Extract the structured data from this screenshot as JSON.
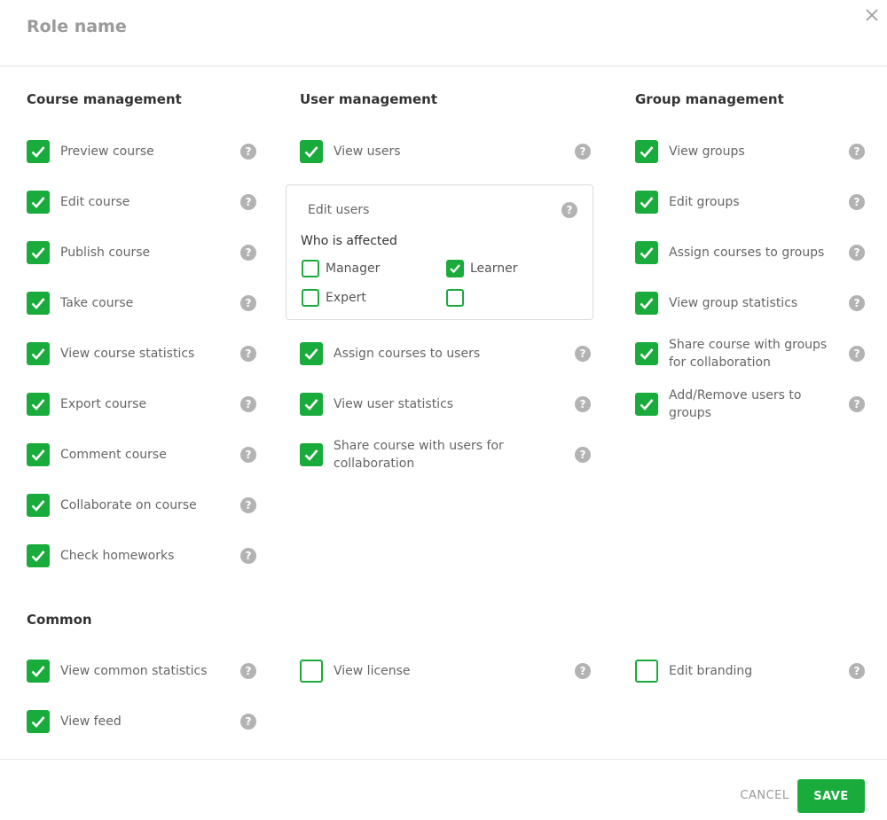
{
  "dialog": {
    "title": "Role name"
  },
  "icons": {
    "close": "close-icon",
    "help": "help-icon",
    "check": "check-icon"
  },
  "colors": {
    "accent": "#1aab3d",
    "help_icon": "#b3b3b3"
  },
  "help_glyph": "?",
  "course_management": {
    "title": "Course management",
    "items": [
      {
        "label": "Preview course",
        "checked": true
      },
      {
        "label": "Edit course",
        "checked": true
      },
      {
        "label": "Publish course",
        "checked": true
      },
      {
        "label": "Take course",
        "checked": true
      },
      {
        "label": "View course statistics",
        "checked": true
      },
      {
        "label": "Export course",
        "checked": true
      },
      {
        "label": "Comment course",
        "checked": true
      },
      {
        "label": "Collaborate on course",
        "checked": true
      },
      {
        "label": "Check homeworks",
        "checked": true
      }
    ]
  },
  "user_management": {
    "title": "User management",
    "view_users": {
      "label": "View users",
      "checked": true
    },
    "edit_users": {
      "label": "Edit users",
      "who_is_affected": "Who is affected",
      "options": [
        {
          "label": "Manager",
          "checked": false
        },
        {
          "label": "Learner",
          "checked": true
        },
        {
          "label": "Expert",
          "checked": false
        },
        {
          "label": "",
          "checked": false
        }
      ]
    },
    "items": [
      {
        "label": "Assign courses to users",
        "checked": true
      },
      {
        "label": "View user statistics",
        "checked": true
      },
      {
        "label": "Share course with users for collaboration",
        "checked": true
      }
    ]
  },
  "group_management": {
    "title": "Group management",
    "items": [
      {
        "label": "View groups",
        "checked": true
      },
      {
        "label": "Edit groups",
        "checked": true
      },
      {
        "label": "Assign courses to groups",
        "checked": true
      },
      {
        "label": "View group statistics",
        "checked": true
      },
      {
        "label": "Share course with groups for collaboration",
        "checked": true
      },
      {
        "label": "Add/Remove users to groups",
        "checked": true
      }
    ]
  },
  "common": {
    "title": "Common",
    "items": [
      {
        "label": "View common statistics",
        "checked": true
      },
      {
        "label": "View license",
        "checked": false
      },
      {
        "label": "Edit branding",
        "checked": false
      },
      {
        "label": "View feed",
        "checked": true
      }
    ]
  },
  "footer": {
    "cancel_label": "CANCEL",
    "save_label": "SAVE"
  }
}
